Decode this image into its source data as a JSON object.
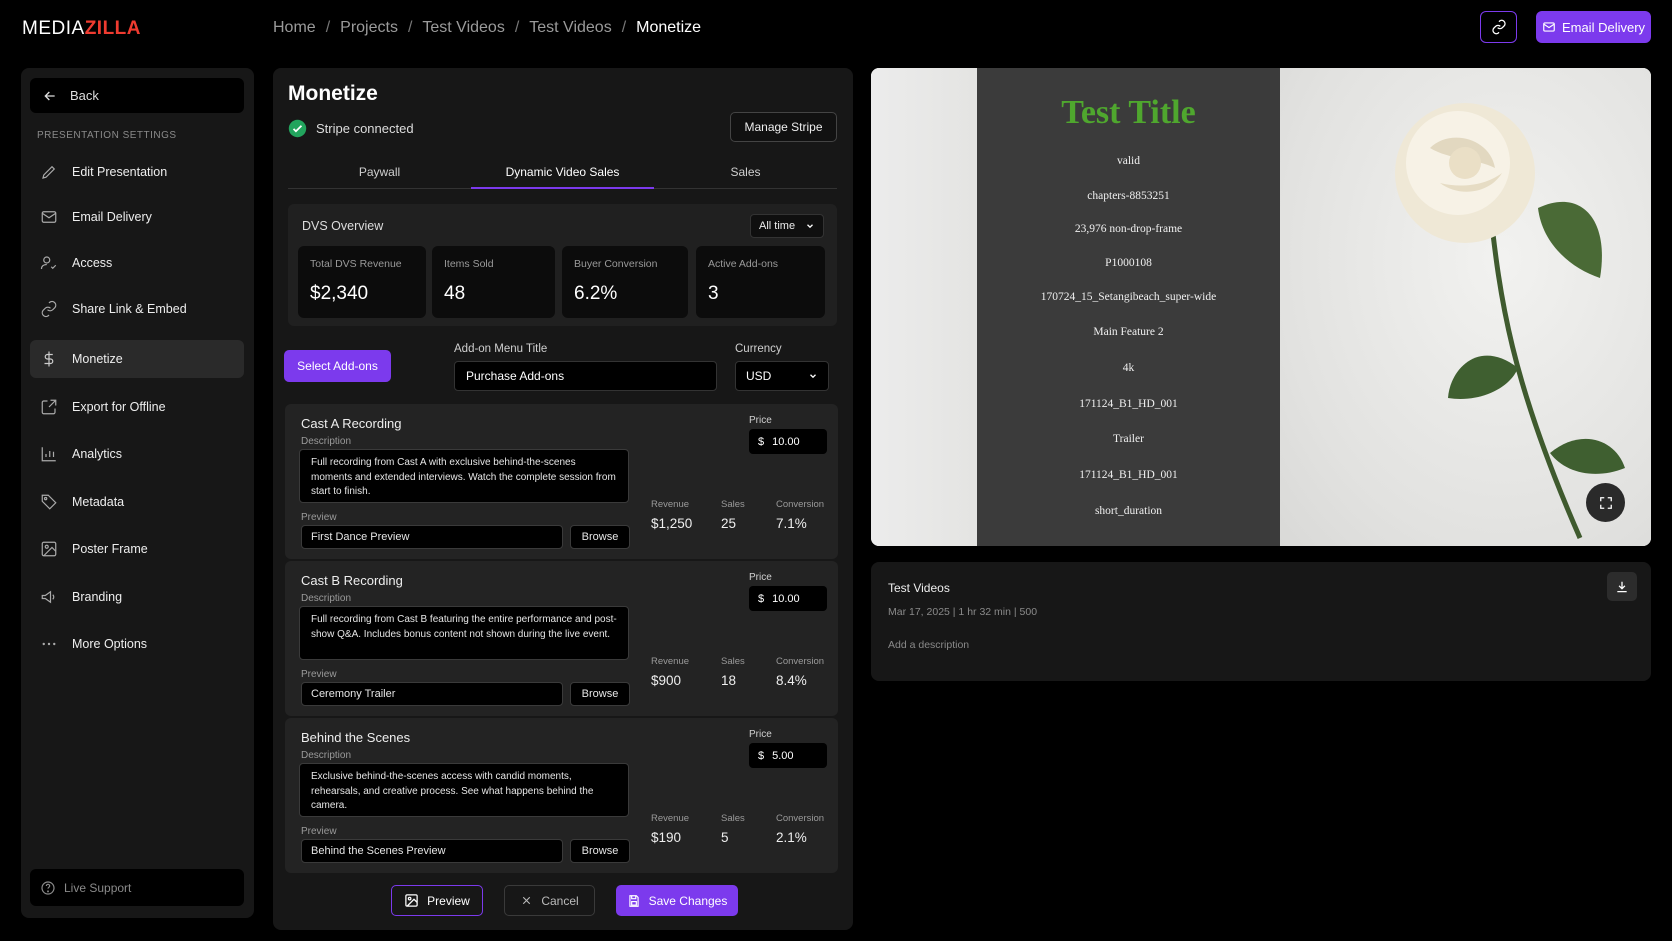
{
  "brand": {
    "logo_prefix": "MEDIA",
    "logo_suffix": "ZILLA"
  },
  "breadcrumb": [
    "Home",
    "Projects",
    "Test Videos",
    "Test Videos",
    "Monetize"
  ],
  "header": {
    "email_delivery": "Email Delivery"
  },
  "sidebar": {
    "back": "Back",
    "section": "PRESENTATION SETTINGS",
    "items": [
      {
        "label": "Edit Presentation",
        "icon": "pencil-icon"
      },
      {
        "label": "Email Delivery",
        "icon": "mail-icon"
      },
      {
        "label": "Access",
        "icon": "user-check-icon"
      },
      {
        "label": "Share Link & Embed",
        "icon": "link-icon"
      },
      {
        "label": "Monetize",
        "icon": "dollar-icon"
      },
      {
        "label": "Export for Offline",
        "icon": "export-icon"
      },
      {
        "label": "Analytics",
        "icon": "chart-icon"
      },
      {
        "label": "Metadata",
        "icon": "tag-icon"
      },
      {
        "label": "Poster Frame",
        "icon": "image-icon"
      },
      {
        "label": "Branding",
        "icon": "megaphone-icon"
      },
      {
        "label": "More Options",
        "icon": "more-icon"
      }
    ],
    "active_index": 4,
    "support": "Live Support"
  },
  "monetize": {
    "title": "Monetize",
    "stripe_status": "Stripe connected",
    "manage_stripe": "Manage Stripe",
    "tabs": [
      "Paywall",
      "Dynamic Video Sales",
      "Sales"
    ],
    "active_tab": 1,
    "overview": {
      "title": "DVS Overview",
      "range": "All time",
      "stats": [
        {
          "label": "Total DVS Revenue",
          "value": "$2,340"
        },
        {
          "label": "Items Sold",
          "value": "48"
        },
        {
          "label": "Buyer Conversion",
          "value": "6.2%"
        },
        {
          "label": "Active Add-ons",
          "value": "3"
        }
      ]
    },
    "select_addons": "Select Add-ons",
    "menu_title_label": "Add-on Menu Title",
    "menu_title_value": "Purchase Add-ons",
    "currency_label": "Currency",
    "currency_value": "USD",
    "field_labels": {
      "description": "Description",
      "preview": "Preview",
      "browse": "Browse",
      "price": "Price",
      "currency_symbol": "$",
      "revenue": "Revenue",
      "sales": "Sales",
      "conversion": "Conversion"
    },
    "addons": [
      {
        "name": "Cast A Recording",
        "description": "Full recording from Cast A with exclusive behind-the-scenes moments and extended interviews. Watch the complete session from start to finish.",
        "preview": "First Dance Preview",
        "price": "10.00",
        "revenue": "$1,250",
        "sales": "25",
        "conversion": "7.1%"
      },
      {
        "name": "Cast B Recording",
        "description": "Full recording from Cast B featuring the entire performance and post-show Q&A. Includes bonus content not shown during the live event.",
        "preview": "Ceremony Trailer",
        "price": "10.00",
        "revenue": "$900",
        "sales": "18",
        "conversion": "8.4%"
      },
      {
        "name": "Behind the Scenes",
        "description": "Exclusive behind-the-scenes access with candid moments, rehearsals, and creative process. See what happens behind the camera.",
        "preview": "Behind the Scenes Preview",
        "price": "5.00",
        "revenue": "$190",
        "sales": "5",
        "conversion": "2.1%"
      }
    ],
    "footer": {
      "preview": "Preview",
      "cancel": "Cancel",
      "save": "Save Changes"
    }
  },
  "video": {
    "title": "Test Title",
    "lines": [
      "valid",
      "chapters-8853251",
      "23,976 non-drop-frame",
      "P1000108",
      "170724_15_Setangibeach_super-wide",
      "Main Feature 2",
      "4k",
      "171124_B1_HD_001",
      "Trailer",
      "171124_B1_HD_001",
      "short_duration"
    ],
    "title_color": "#4fa72e"
  },
  "info": {
    "title": "Test Videos",
    "meta": "Mar 17, 2025 | 1 hr 32 min | 500",
    "description_placeholder": "Add a description"
  },
  "colors": {
    "accent": "#7c3aed",
    "success": "#22a45d",
    "brand_red": "#ef3b30"
  }
}
